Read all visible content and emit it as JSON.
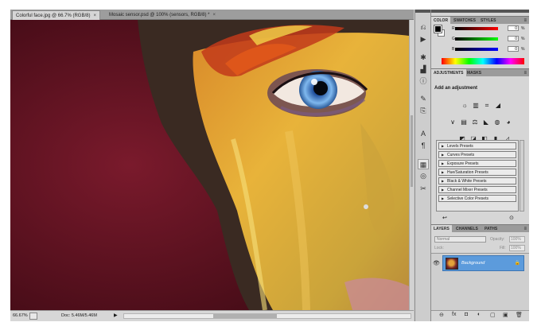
{
  "document_tabs": [
    {
      "label": "Colorful face.jpg @ 66.7% (RGB/8)",
      "close": "×"
    },
    {
      "label": "Mosaic sensor.psd @ 100% (sensors, RGB/8) *",
      "close": "×"
    }
  ],
  "status": {
    "zoom": "66.67%",
    "doc_info": "Doc: 5.46M/5.46M",
    "arrow": "▶"
  },
  "color_panel": {
    "tabs": [
      "COLOR",
      "SWATCHES",
      "STYLES"
    ],
    "menu": "≡",
    "channels": [
      {
        "label": "R",
        "value": "0",
        "unit": "%"
      },
      {
        "label": "G",
        "value": "0",
        "unit": "%"
      },
      {
        "label": "B",
        "value": "0",
        "unit": "%"
      }
    ],
    "foreground": "#000000",
    "background": "#ffffff"
  },
  "adjustments_panel": {
    "tabs": [
      "ADJUSTMENTS",
      "MASKS"
    ],
    "menu": "≡",
    "title": "Add an adjustment",
    "row1": [
      "☼",
      "▥",
      "⌗",
      "◢"
    ],
    "row2": [
      "∨",
      "▤",
      "⚖",
      "◣",
      "◍",
      "◕"
    ],
    "row3": [
      "◩",
      "◪",
      "◧",
      "▮",
      "◿"
    ],
    "presets": [
      "Levels Presets",
      "Curves Presets",
      "Exposure Presets",
      "Hue/Saturation Presets",
      "Black & White Presets",
      "Channel Mixer Presets",
      "Selective Color Presets"
    ]
  },
  "layers_panel": {
    "tabs": [
      "LAYERS",
      "CHANNELS",
      "PATHS"
    ],
    "menu": "≡",
    "blend_mode": "Normal",
    "opacity_label": "Opacity:",
    "lock_label": "Lock:",
    "fill_label": "Fill:",
    "opacity_value": "100%",
    "fill_value": "100%",
    "layers": [
      {
        "name": "Background",
        "visible": "👁",
        "locked": "🔒"
      }
    ],
    "footer_icons": [
      "⊖",
      "fx",
      "◘",
      "◐",
      "▢",
      "▣",
      "🗑"
    ]
  },
  "colors": {
    "selection": "#5c9bdc",
    "canvas_bg": "#5c1020"
  }
}
